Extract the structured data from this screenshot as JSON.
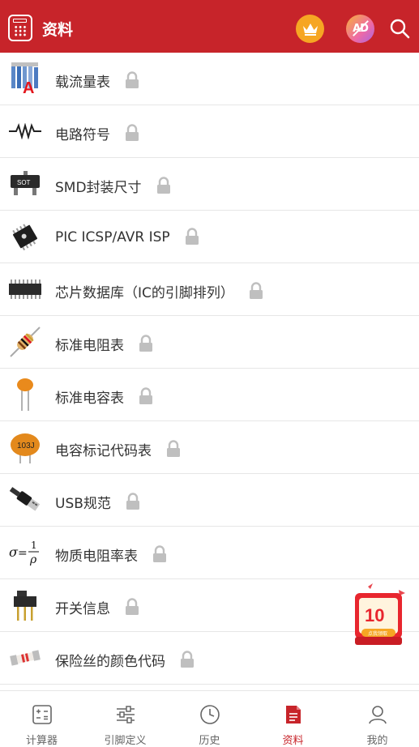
{
  "header": {
    "title": "资料",
    "ad_label": "AD"
  },
  "colors": {
    "brand": "#c7242a",
    "vip": "#f6a623",
    "lock": "#bfbfbf"
  },
  "items": [
    {
      "label": "载流量表",
      "icon": "wire-ampacity-icon",
      "locked": true
    },
    {
      "label": "电路符号",
      "icon": "resistor-symbol-icon",
      "locked": true
    },
    {
      "label": "SMD封装尺寸",
      "icon": "sot-package-icon",
      "locked": true
    },
    {
      "label": "PIC ICSP/AVR ISP",
      "icon": "microchip-icon",
      "locked": true
    },
    {
      "label": "芯片数据库（IC的引脚排列）",
      "icon": "dip-ic-icon",
      "locked": true
    },
    {
      "label": "标准电阻表",
      "icon": "resistor-icon",
      "locked": true
    },
    {
      "label": "标准电容表",
      "icon": "ceramic-capacitor-icon",
      "locked": true
    },
    {
      "label": "电容标记代码表",
      "icon": "capacitor-code-icon",
      "locked": true
    },
    {
      "label": "USB规范",
      "icon": "usb-plug-icon",
      "locked": true
    },
    {
      "label": "物质电阻率表",
      "icon": "resistivity-formula-icon",
      "locked": true
    },
    {
      "label": "开关信息",
      "icon": "slide-switch-icon",
      "locked": true
    },
    {
      "label": "保险丝的颜色代码",
      "icon": "fuse-icon",
      "locked": true
    }
  ],
  "thumb_text": {
    "wire_letter": "A",
    "sot": "SOT",
    "cap_code": "103J",
    "formula": "σ = 1/ρ"
  },
  "promo": {
    "amount": "10",
    "caption": "点我领取"
  },
  "tabs": [
    {
      "label": "计算器",
      "icon": "calculator-icon",
      "active": false
    },
    {
      "label": "引脚定义",
      "icon": "sliders-icon",
      "active": false
    },
    {
      "label": "历史",
      "icon": "clock-icon",
      "active": false
    },
    {
      "label": "资料",
      "icon": "document-icon",
      "active": true
    },
    {
      "label": "我的",
      "icon": "user-icon",
      "active": false
    }
  ]
}
